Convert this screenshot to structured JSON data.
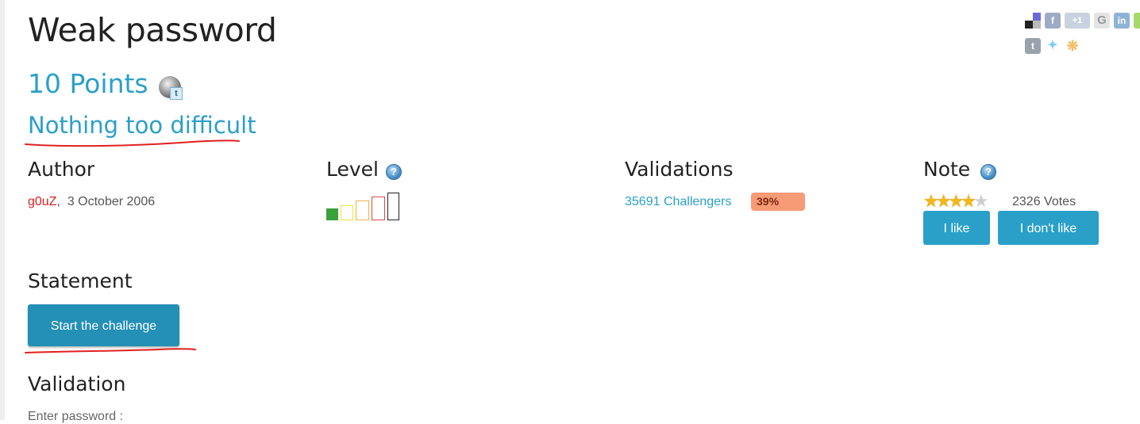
{
  "challenge": {
    "title": "Weak password",
    "points": "10 Points",
    "subtitle": "Nothing too difficult"
  },
  "author": {
    "heading": "Author",
    "name": "g0uZ",
    "separator": ",",
    "date": "3 October 2006"
  },
  "level": {
    "heading": "Level",
    "help_icon": "?",
    "current": 1,
    "max": 5
  },
  "validations": {
    "heading": "Validations",
    "challengers": "35691 Challengers",
    "percent_label": "39%"
  },
  "note": {
    "heading": "Note",
    "help_icon": "?",
    "rating": 4,
    "max_rating": 5,
    "votes": "2326 Votes",
    "like_label": "I like",
    "dislike_label": "I don't like"
  },
  "statement": {
    "heading": "Statement",
    "start_label": "Start the challenge"
  },
  "validation": {
    "heading": "Validation",
    "enter_label": "Enter password :"
  },
  "icons": {
    "points_icon": "tutorial-badge-icon",
    "social": [
      "delicious-icon",
      "facebook-icon",
      "google-plus-icon",
      "google-icon",
      "linkedin-icon",
      "tumblr-icon",
      "twitter-icon",
      "addthis-icon"
    ]
  },
  "colors": {
    "accent": "#2aa0c9",
    "author_link": "#d81f1f",
    "percent_badge": "#f79a76",
    "star_on": "#f3b718",
    "level_on": "#3aa03a"
  }
}
